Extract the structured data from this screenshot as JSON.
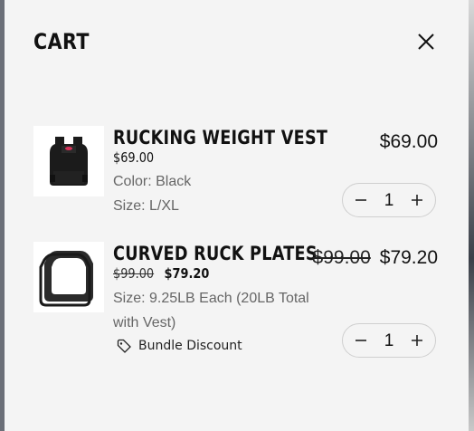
{
  "cart": {
    "title": "CART",
    "items": [
      {
        "name": "RUCKING WEIGHT VEST",
        "price": "$69.00",
        "color": "Color: Black",
        "size": "Size: L/XL",
        "line_total": "$69.00",
        "quantity": "1"
      },
      {
        "name": "CURVED RUCK PLATES",
        "original_price": "$99.00",
        "sale_price": "$79.20",
        "size_line1": "Size: 9.25LB Each (20LB Total",
        "size_line2": "with Vest)",
        "discount_label": "Bundle Discount",
        "line_total_original": "$99.00",
        "line_total": "$79.20",
        "quantity": "1"
      }
    ]
  }
}
